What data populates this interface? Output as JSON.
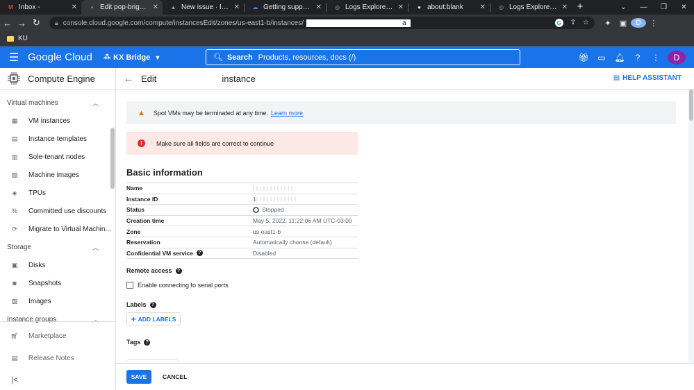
{
  "browser": {
    "tabs": [
      {
        "title": "Inbox -",
        "icon": "gmail-icon",
        "color": "#ea4335",
        "glyph": "M"
      },
      {
        "title": "Edit pop-bright-bridg",
        "icon": "cloud-icon",
        "color": "#8ab4f8",
        "glyph": "▪",
        "active": true
      },
      {
        "title": "New issue · Issue Trac",
        "icon": "issue-tracker-icon",
        "color": "#9aa0a6",
        "glyph": "▲"
      },
      {
        "title": "Getting support with",
        "icon": "google-cloud-icon",
        "color": "#4285f4",
        "glyph": "☁"
      },
      {
        "title": "Logs Explorer – Loggi",
        "icon": "logs-icon",
        "color": "#9aa0a6",
        "glyph": "◎"
      },
      {
        "title": "about:blank",
        "icon": "globe-icon",
        "color": "#e8eaed",
        "glyph": "●"
      },
      {
        "title": "Logs Explorer – Loggi",
        "icon": "logs-icon",
        "color": "#9aa0a6",
        "glyph": "◎"
      }
    ],
    "url": "console.cloud.google.com/compute/instancesEdit/zones/us-east1-b/instances/",
    "url_tail": "a",
    "bookmark": "KU",
    "profile_initial": "D"
  },
  "header": {
    "brand": "Google Cloud",
    "project": "KX Bridge",
    "search_label": "Search",
    "search_placeholder": "Products, resources, docs (/)",
    "avatar_initial": "D"
  },
  "sidebar": {
    "title": "Compute Engine",
    "sections": [
      {
        "label": "Virtual machines",
        "items": [
          {
            "label": "VM instances",
            "icon": "vm-icon"
          },
          {
            "label": "Instance templates",
            "icon": "template-icon"
          },
          {
            "label": "Sole-tenant nodes",
            "icon": "node-icon"
          },
          {
            "label": "Machine images",
            "icon": "image-icon"
          },
          {
            "label": "TPUs",
            "icon": "tpu-icon"
          },
          {
            "label": "Committed use discounts",
            "icon": "discount-icon"
          },
          {
            "label": "Migrate to Virtual Machin...",
            "icon": "migrate-icon"
          }
        ]
      },
      {
        "label": "Storage",
        "items": [
          {
            "label": "Disks",
            "icon": "disk-icon"
          },
          {
            "label": "Snapshots",
            "icon": "snapshot-icon"
          },
          {
            "label": "Images",
            "icon": "images-icon"
          }
        ]
      },
      {
        "label": "Instance groups",
        "items": []
      }
    ],
    "footer": [
      {
        "label": "Marketplace",
        "icon": "cart-icon"
      },
      {
        "label": "Release Notes",
        "icon": "notes-icon"
      }
    ]
  },
  "main": {
    "title_prefix": "Edit",
    "title_suffix": "instance",
    "help_assistant": "HELP ASSISTANT",
    "warning": {
      "text": "Spot VMs may be terminated at any time.",
      "link": "Learn more"
    },
    "error": "Make sure all fields are correct to continue",
    "section_title": "Basic information",
    "info": [
      {
        "key": "Name",
        "value": ""
      },
      {
        "key": "Instance ID",
        "value": "1"
      },
      {
        "key": "Status",
        "value": "Stopped"
      },
      {
        "key": "Creation time",
        "value": "May 5, 2022, 11:22:06 AM UTC-03:00"
      },
      {
        "key": "Zone",
        "value": "us-east1-b"
      },
      {
        "key": "Reservation",
        "value": "Automatically choose (default)"
      },
      {
        "key": "Confidential VM service",
        "value": "Disabled"
      }
    ],
    "remote_access": "Remote access",
    "serial_ports": "Enable connecting to serial ports",
    "labels": "Labels",
    "add_labels": "ADD LABELS",
    "tags": "Tags",
    "save": "SAVE",
    "cancel": "CANCEL"
  }
}
